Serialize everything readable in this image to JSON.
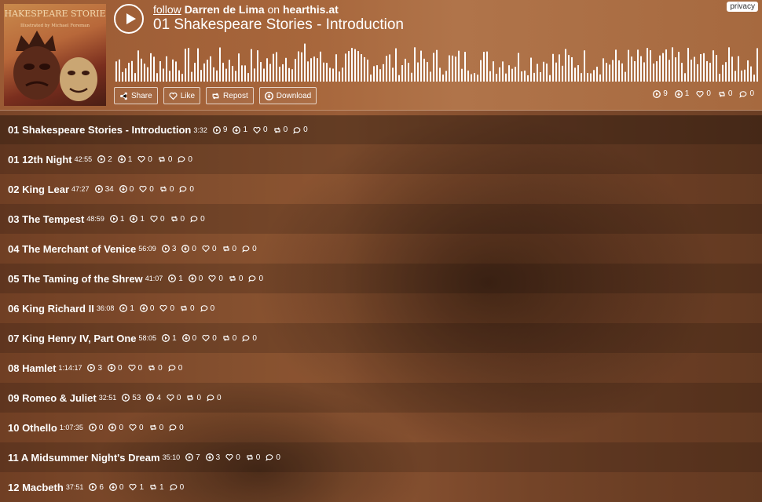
{
  "header": {
    "cover_title": "SHAKESPEARE STORIES",
    "cover_subtitle": "Illustrated by Michael Foreman",
    "follow_label": "follow",
    "artist": "Darren de Lima",
    "on_label": "on",
    "site": "hearthis.at",
    "title": "01 Shakespeare Stories - Introduction",
    "privacy_label": "privacy",
    "buttons": {
      "share": "Share",
      "like": "Like",
      "repost": "Repost",
      "download": "Download"
    },
    "stats": {
      "plays": "9",
      "downloads": "1",
      "likes": "0",
      "reposts": "0",
      "comments": "0"
    }
  },
  "icons": [
    "play-icon",
    "share-icon",
    "heart-icon",
    "repost-icon",
    "download-icon",
    "comment-icon"
  ],
  "colors": {
    "accent": "#ffffff",
    "header_bg": "#a7663b",
    "body_bg": "#8d5431"
  },
  "tracks": [
    {
      "title": "01 Shakespeare Stories - Introduction",
      "duration": "3:32",
      "plays": "9",
      "downloads": "1",
      "likes": "0",
      "reposts": "0",
      "comments": "0"
    },
    {
      "title": "01 12th Night",
      "duration": "42:55",
      "plays": "2",
      "downloads": "1",
      "likes": "0",
      "reposts": "0",
      "comments": "0"
    },
    {
      "title": "02 King Lear",
      "duration": "47:27",
      "plays": "34",
      "downloads": "0",
      "likes": "0",
      "reposts": "0",
      "comments": "0"
    },
    {
      "title": "03 The Tempest",
      "duration": "48:59",
      "plays": "1",
      "downloads": "1",
      "likes": "0",
      "reposts": "0",
      "comments": "0"
    },
    {
      "title": "04 The Merchant of Venice",
      "duration": "56:09",
      "plays": "3",
      "downloads": "0",
      "likes": "0",
      "reposts": "0",
      "comments": "0"
    },
    {
      "title": "05 The Taming of the Shrew",
      "duration": "41:07",
      "plays": "1",
      "downloads": "0",
      "likes": "0",
      "reposts": "0",
      "comments": "0"
    },
    {
      "title": "06 King Richard II",
      "duration": "36:08",
      "plays": "1",
      "downloads": "0",
      "likes": "0",
      "reposts": "0",
      "comments": "0"
    },
    {
      "title": "07 King Henry IV, Part One",
      "duration": "58:05",
      "plays": "1",
      "downloads": "0",
      "likes": "0",
      "reposts": "0",
      "comments": "0"
    },
    {
      "title": "08 Hamlet",
      "duration": "1:14:17",
      "plays": "3",
      "downloads": "0",
      "likes": "0",
      "reposts": "0",
      "comments": "0"
    },
    {
      "title": "09 Romeo & Juliet",
      "duration": "32:51",
      "plays": "53",
      "downloads": "4",
      "likes": "0",
      "reposts": "0",
      "comments": "0"
    },
    {
      "title": "10 Othello",
      "duration": "1:07:35",
      "plays": "0",
      "downloads": "0",
      "likes": "0",
      "reposts": "0",
      "comments": "0"
    },
    {
      "title": "11 A Midsummer Night's Dream",
      "duration": "35:10",
      "plays": "7",
      "downloads": "3",
      "likes": "0",
      "reposts": "0",
      "comments": "0"
    },
    {
      "title": "12 Macbeth",
      "duration": "37:51",
      "plays": "6",
      "downloads": "0",
      "likes": "1",
      "reposts": "1",
      "comments": "0"
    }
  ]
}
